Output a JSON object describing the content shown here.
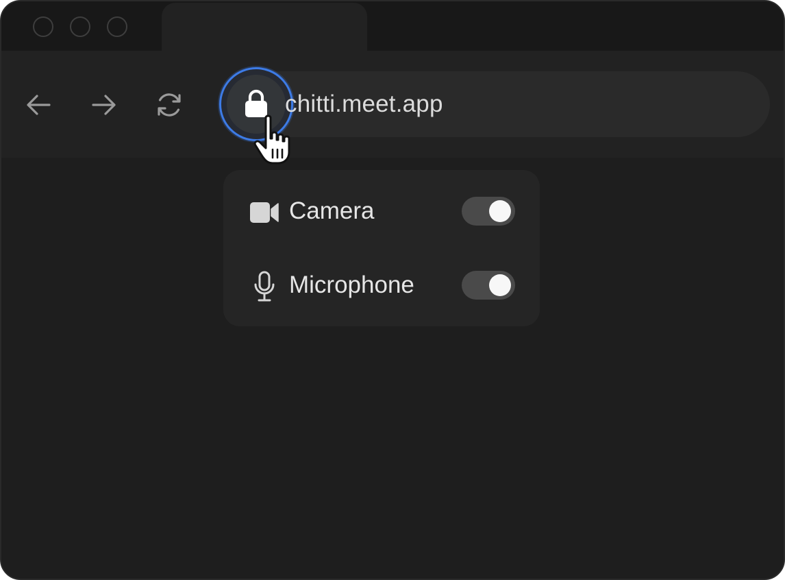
{
  "window": {
    "traffic_lights": [
      "close",
      "minimize",
      "maximize"
    ]
  },
  "toolbar": {
    "back_icon": "arrow-left-icon",
    "forward_icon": "arrow-right-icon",
    "reload_icon": "refresh-icon"
  },
  "address_bar": {
    "url": "chitti.meet.app",
    "site_info_icon": "lock-icon"
  },
  "permissions_popup": {
    "items": [
      {
        "label": "Camera",
        "icon": "video-camera-icon",
        "enabled": true
      },
      {
        "label": "Microphone",
        "icon": "microphone-icon",
        "enabled": true
      }
    ]
  },
  "colors": {
    "accent": "#3d7be6",
    "window_bg": "#1e1e1e",
    "toolbar_bg": "#222222",
    "popup_bg": "#252525",
    "toggle_track": "#4a4a4a",
    "toggle_knob": "#f7f7f7"
  }
}
